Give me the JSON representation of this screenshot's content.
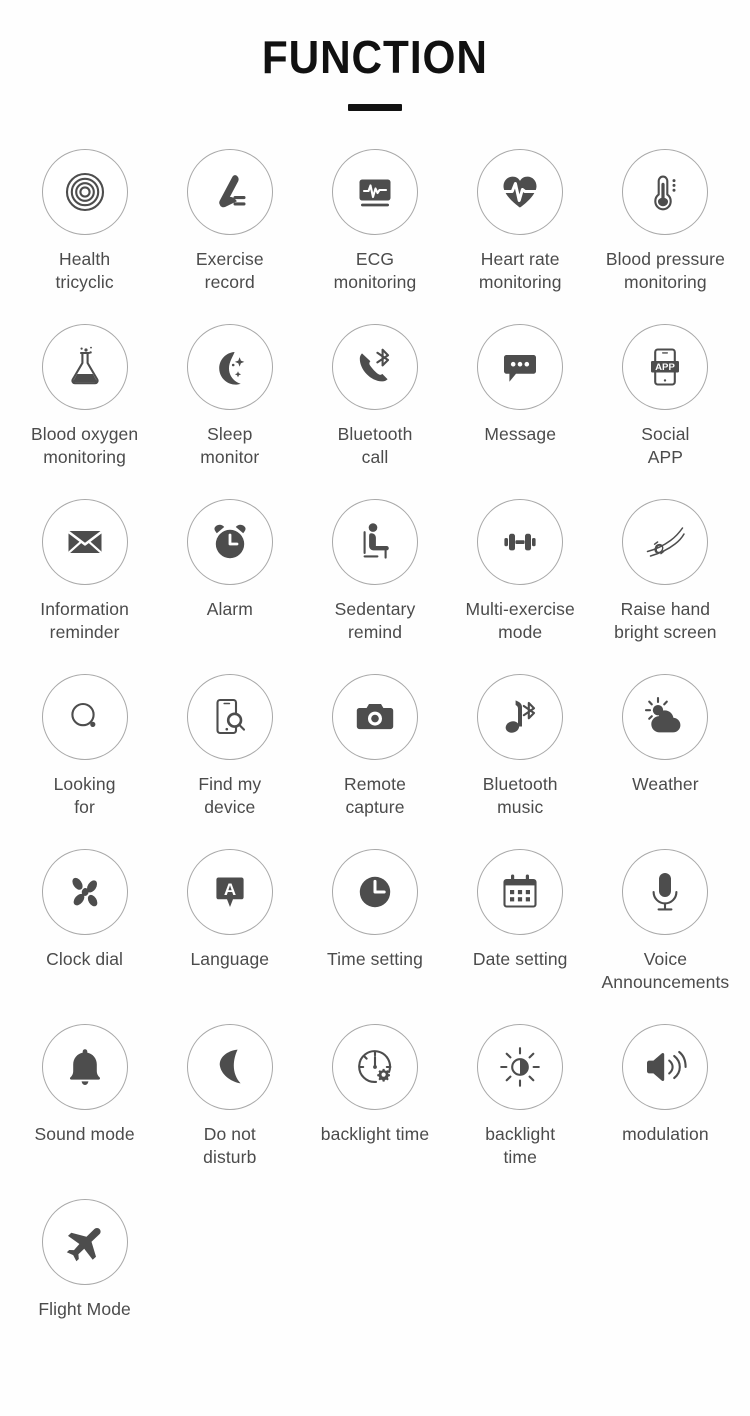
{
  "header": {
    "title": "FUNCTION",
    "rule": "divider-bar"
  },
  "colors": {
    "background": "#fefefe",
    "title": "#111111",
    "label": "#4b4b4b",
    "icon": "#4d4d4d",
    "circle_border": "#a8a8a8"
  },
  "grid": {
    "columns": 5,
    "rows": 7,
    "items": [
      {
        "label": "Health\ntricyclic",
        "icon": "health-rings-icon"
      },
      {
        "label": "Exercise\nrecord",
        "icon": "running-shoe-icon"
      },
      {
        "label": "ECG\nmonitoring",
        "icon": "ecg-monitor-icon"
      },
      {
        "label": "Heart rate\nmonitoring",
        "icon": "heart-pulse-icon"
      },
      {
        "label": "Blood pressure\nmonitoring",
        "icon": "thermometer-icon"
      },
      {
        "label": "Blood oxygen\nmonitoring",
        "icon": "flask-icon"
      },
      {
        "label": "Sleep\nmonitor",
        "icon": "moon-stars-icon"
      },
      {
        "label": "Bluetooth\ncall",
        "icon": "bluetooth-phone-icon"
      },
      {
        "label": "Message",
        "icon": "chat-bubble-icon"
      },
      {
        "label": "Social\nAPP",
        "icon": "phone-app-icon"
      },
      {
        "label": "Information\nreminder",
        "icon": "envelope-icon"
      },
      {
        "label": "Alarm",
        "icon": "alarm-clock-icon"
      },
      {
        "label": "Sedentary\nremind",
        "icon": "sitting-person-icon"
      },
      {
        "label": "Multi-exercise\nmode",
        "icon": "dumbbell-icon"
      },
      {
        "label": "Raise hand\nbright screen",
        "icon": "raise-wrist-icon"
      },
      {
        "label": "Looking\nfor",
        "icon": "magnifier-icon"
      },
      {
        "label": "Find my\ndevice",
        "icon": "find-phone-icon"
      },
      {
        "label": "Remote\ncapture",
        "icon": "camera-icon"
      },
      {
        "label": "Bluetooth\nmusic",
        "icon": "bluetooth-music-icon"
      },
      {
        "label": "Weather",
        "icon": "sun-cloud-icon"
      },
      {
        "label": "Clock dial",
        "icon": "clock-dial-petals-icon"
      },
      {
        "label": "Language",
        "icon": "language-a-icon"
      },
      {
        "label": "Time setting",
        "icon": "clock-icon"
      },
      {
        "label": "Date setting",
        "icon": "calendar-icon"
      },
      {
        "label": "Voice\nAnnouncements",
        "icon": "microphone-icon"
      },
      {
        "label": "Sound mode",
        "icon": "bell-icon"
      },
      {
        "label": "Do not\ndisturb",
        "icon": "crescent-moon-icon"
      },
      {
        "label": "backlight time",
        "icon": "gauge-gear-icon"
      },
      {
        "label": "backlight\ntime",
        "icon": "brightness-icon"
      },
      {
        "label": "modulation",
        "icon": "speaker-volume-icon"
      },
      {
        "label": "Flight Mode",
        "icon": "airplane-icon"
      }
    ]
  }
}
